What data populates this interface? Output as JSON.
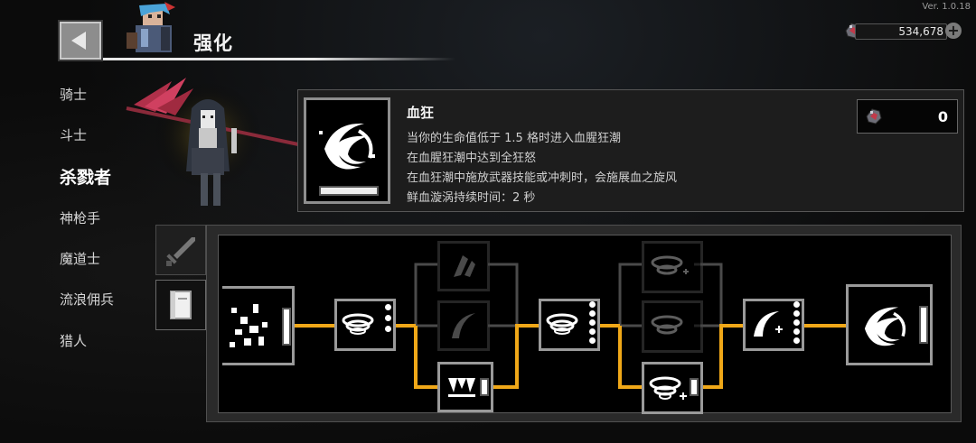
{
  "version": "Ver. 1.0.18",
  "header": {
    "title": "强化",
    "back_icon": "back-arrow-icon"
  },
  "currency": {
    "value": "534,678",
    "icon": "gem-icon",
    "add_icon": "plus-icon"
  },
  "classes": [
    {
      "label": "骑士",
      "active": false
    },
    {
      "label": "斗士",
      "active": false
    },
    {
      "label": "杀戮者",
      "active": true
    },
    {
      "label": "神枪手",
      "active": false
    },
    {
      "label": "魔道士",
      "active": false
    },
    {
      "label": "流浪佣兵",
      "active": false
    },
    {
      "label": "猎人",
      "active": false
    }
  ],
  "skill": {
    "name": "血狂",
    "desc": [
      "当你的生命值低于 1.5 格时进入血腥狂潮",
      "在血腥狂潮中达到全狂怒",
      "在血狂潮中施放武器技能或冲刺时，会施展血之旋风",
      "鲜血漩涡持续时间：2 秒"
    ],
    "cost": "0"
  },
  "tabs": [
    {
      "name": "sword-tab",
      "icon": "sword-icon",
      "active": false
    },
    {
      "name": "book-tab",
      "icon": "book-icon",
      "active": true
    }
  ],
  "colors": {
    "active_path": "#f0a818",
    "inactive_path": "#4a4a4a",
    "accent_red": "#c0304a"
  }
}
